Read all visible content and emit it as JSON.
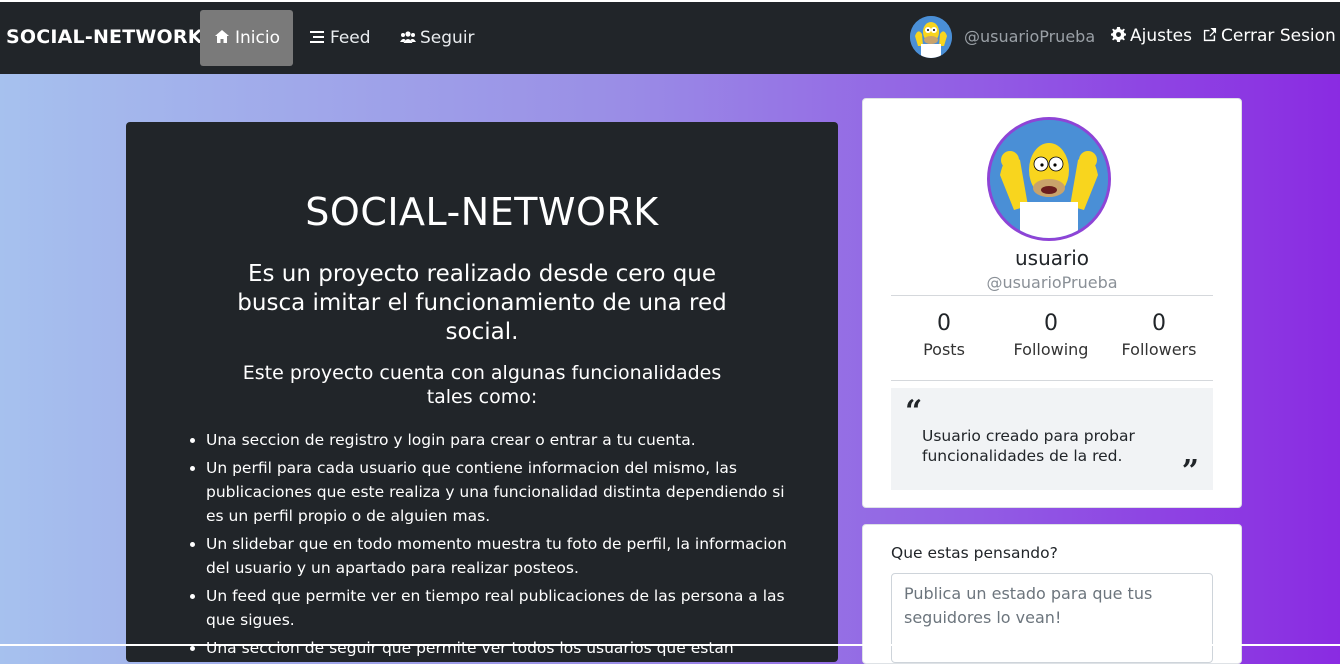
{
  "navbar": {
    "brand": "SOCIAL-NETWORK",
    "items": [
      {
        "label": "Inicio",
        "icon": "home-icon",
        "active": true
      },
      {
        "label": "Feed",
        "icon": "list-icon",
        "active": false
      },
      {
        "label": "Seguir",
        "icon": "users-icon",
        "active": false
      }
    ],
    "user_handle": "@usuarioPrueba",
    "settings_label": "Ajustes",
    "logout_label": "Cerrar Sesion"
  },
  "hero": {
    "title": "SOCIAL-NETWORK",
    "lead": "Es un proyecto realizado desde cero que busca imitar el funcionamiento de una red social.",
    "sub": "Este proyecto cuenta con algunas funcionalidades tales como:",
    "features": [
      "Una seccion de registro y login para crear o entrar a tu cuenta.",
      "Un perfil para cada usuario que contiene informacion del mismo, las publicaciones que este realiza y una funcionalidad distinta dependiendo si es un perfil propio o de alguien mas.",
      "Un slidebar que en todo momento muestra tu foto de perfil, la informacion del usuario y un apartado para realizar posteos.",
      "Un feed que permite ver en tiempo real publicaciones de las persona a las que sigues.",
      "Una seccion de seguir que permite ver todos los usuarios que estan"
    ]
  },
  "profile": {
    "name": "usuario",
    "handle": "@usuarioPrueba",
    "stats": [
      {
        "value": "0",
        "label": "Posts"
      },
      {
        "value": "0",
        "label": "Following"
      },
      {
        "value": "0",
        "label": "Followers"
      }
    ],
    "bio": "Usuario creado para probar funcionalidades de la red."
  },
  "post": {
    "label": "Que estas pensando?",
    "placeholder": "Publica un estado para que tus seguidores lo vean!"
  },
  "colors": {
    "navbar_bg": "#212529",
    "gradient_start": "#a6c1ee",
    "gradient_end": "#8a2be2",
    "avatar_border": "#8e44d6"
  }
}
